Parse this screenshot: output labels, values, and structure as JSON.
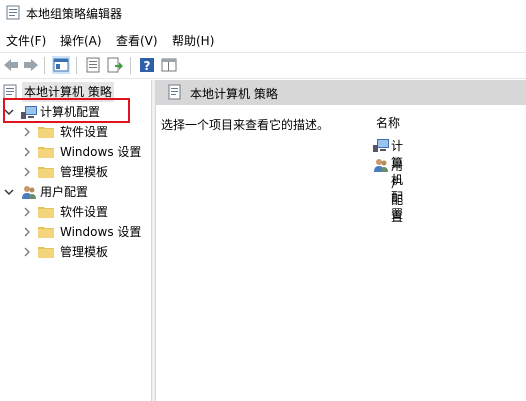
{
  "window": {
    "title": "本地组策略编辑器"
  },
  "menu": {
    "file": "文件(F)",
    "action": "操作(A)",
    "view": "查看(V)",
    "help": "帮助(H)"
  },
  "tree": {
    "root": "本地计算机 策略",
    "computer_config": "计算机配置",
    "computer_children": [
      "软件设置",
      "Windows 设置",
      "管理模板"
    ],
    "user_config": "用户配置",
    "user_children": [
      "软件设置",
      "Windows 设置",
      "管理模板"
    ]
  },
  "right": {
    "header": "本地计算机 策略",
    "description": "选择一个项目来查看它的描述。",
    "column_name": "名称",
    "items": [
      "计算机配置",
      "用户配置"
    ]
  },
  "colors": {
    "highlight": "#e0141e",
    "header_bg": "#d7d7d7",
    "folder": "#e8c25a"
  },
  "icons": [
    "back-arrow-icon",
    "forward-arrow-icon",
    "console-tree-icon",
    "properties-icon",
    "export-list-icon",
    "help-icon",
    "extended-view-icon"
  ]
}
